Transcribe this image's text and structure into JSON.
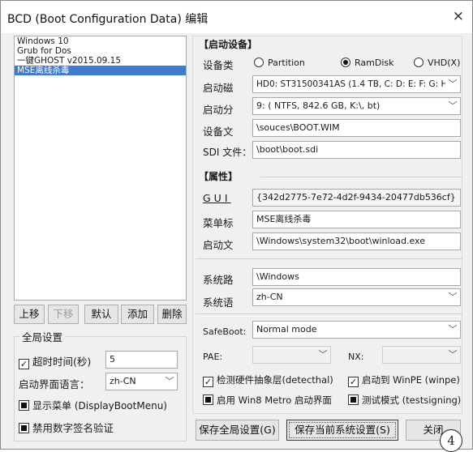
{
  "window": {
    "title": "BCD (Boot Configuration Data) 编辑",
    "close": "×"
  },
  "entries": {
    "items": [
      "Windows 10",
      "Grub for Dos",
      "一键GHOST v2015.09.15",
      "MSE离线杀毒"
    ],
    "selected_index": 3
  },
  "entry_buttons": {
    "up": "上移",
    "down": "下移",
    "default": "默认",
    "add": "添加",
    "delete": "删除"
  },
  "global": {
    "title": "全局设置",
    "timeout_label": "超时时间(秒)",
    "timeout_value": "5",
    "timeout_checked": true,
    "boot_lang_label": "启动界面语言：",
    "boot_lang_value": "zh-CN",
    "display_menu_label": "显示菜单 (DisplayBootMenu)",
    "disable_sig_label": "禁用数字签名验证"
  },
  "boot_device": {
    "title": "【启动设备】",
    "type_label": "设备类",
    "types": [
      "Partition",
      "RamDisk",
      "VHD(X)"
    ],
    "selected_type": "RamDisk",
    "disk_label": "启动磁",
    "disk_value": "HD0: ST31500341AS (1.4 TB, C: D: E: F: G: H",
    "partition_label": "启动分",
    "partition_value": "9: ( NTFS, 842.6 GB, K:\\, bt)",
    "file_label": "设备文",
    "file_value": "\\souces\\BOOT.WIM",
    "sdi_label": "SDI 文件：",
    "sdi_value": "\\boot\\boot.sdi"
  },
  "properties": {
    "title": "【属性】",
    "guid_label": "GUI",
    "guid_value": "{342d2775-7e72-4d2f-9434-20477db536cf}",
    "menu_label": "菜单标",
    "menu_value": "MSE离线杀毒",
    "bootfile_label": "启动文",
    "bootfile_value": "\\Windows\\system32\\boot\\winload.exe",
    "syspath_label": "系统路",
    "syspath_value": "\\Windows",
    "syslang_label": "系统语",
    "syslang_value": "zh-CN",
    "safeboot_label": "SafeBoot:",
    "safeboot_value": "Normal mode",
    "pae_label": "PAE:",
    "pae_value": "",
    "nx_label": "NX:",
    "nx_value": "",
    "detecthal_label": "检测硬件抽象层(detecthal)",
    "detecthal_checked": true,
    "winpe_label": "启动到 WinPE (winpe)",
    "winpe_checked": true,
    "metro_label": "启用 Win8 Metro 启动界面",
    "testsign_label": "测试模式 (testsigning)"
  },
  "footer": {
    "save_global": "保存全局设置(G)",
    "save_current": "保存当前系统设置(S)",
    "close": "关闭"
  },
  "badge": "4"
}
